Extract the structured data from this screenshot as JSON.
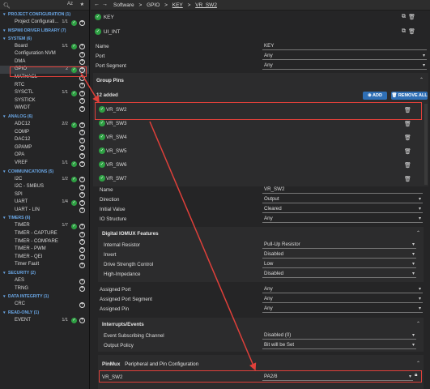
{
  "left": {
    "search_icon": "search-icon",
    "sort_label": "Az",
    "star_icon": "star-icon",
    "sections": [
      {
        "title": "PROJECT CONFIGURATION (1)",
        "items": [
          {
            "label": "Project Configurati...",
            "count": "1/1",
            "check": true
          }
        ]
      },
      {
        "title": "MSPM0 DRIVER LIBRARY (7)",
        "items": []
      },
      {
        "title": "SYSTEM (6)",
        "items": [
          {
            "label": "Board",
            "count": "1/1",
            "check": true
          },
          {
            "label": "Configuration NVM",
            "count": "",
            "check": false
          },
          {
            "label": "DMA",
            "count": "",
            "check": false
          },
          {
            "label": "GPIO",
            "count": "2",
            "check": true,
            "selected": true
          },
          {
            "label": "MATHACL",
            "count": "",
            "check": false
          },
          {
            "label": "RTC",
            "count": "",
            "check": false
          },
          {
            "label": "SYSCTL",
            "count": "1/1",
            "check": true
          },
          {
            "label": "SYSTICK",
            "count": "",
            "check": false
          },
          {
            "label": "WWDT",
            "count": "",
            "check": false
          }
        ]
      },
      {
        "title": "ANALOG (6)",
        "items": [
          {
            "label": "ADC12",
            "count": "2/2",
            "check": true
          },
          {
            "label": "COMP",
            "count": "",
            "check": false
          },
          {
            "label": "DAC12",
            "count": "",
            "check": false
          },
          {
            "label": "GPAMP",
            "count": "",
            "check": false
          },
          {
            "label": "OPA",
            "count": "",
            "check": false
          },
          {
            "label": "VREF",
            "count": "1/1",
            "check": true
          }
        ]
      },
      {
        "title": "COMMUNICATIONS (5)",
        "items": [
          {
            "label": "I2C",
            "count": "1/2",
            "check": true
          },
          {
            "label": "I2C - SMBUS",
            "count": "",
            "check": false
          },
          {
            "label": "SPI",
            "count": "",
            "check": false
          },
          {
            "label": "UART",
            "count": "1/4",
            "check": true
          },
          {
            "label": "UART - LIN",
            "count": "",
            "check": false
          }
        ]
      },
      {
        "title": "TIMERS (6)",
        "items": [
          {
            "label": "TIMER",
            "count": "1/7",
            "check": true
          },
          {
            "label": "TIMER - CAPTURE",
            "count": "",
            "check": false
          },
          {
            "label": "TIMER - COMPARE",
            "count": "",
            "check": false
          },
          {
            "label": "TIMER - PWM",
            "count": "",
            "check": false
          },
          {
            "label": "TIMER - QEI",
            "count": "",
            "check": false
          },
          {
            "label": "Timer Fault",
            "count": "",
            "check": false
          }
        ]
      },
      {
        "title": "SECURITY (2)",
        "items": [
          {
            "label": "AES",
            "count": "",
            "check": false
          },
          {
            "label": "TRNG",
            "count": "",
            "check": false
          }
        ]
      },
      {
        "title": "DATA INTEGRITY (1)",
        "items": [
          {
            "label": "CRC",
            "count": "",
            "check": false
          }
        ]
      },
      {
        "title": "READ-ONLY (1)",
        "items": [
          {
            "label": "EVENT",
            "count": "1/1",
            "check": true
          }
        ]
      }
    ]
  },
  "topbar": {
    "back_icon": "back-arrow-icon",
    "forward_icon": "forward-arrow-icon",
    "breadcrumb": [
      "Software",
      ">",
      "GPIO",
      ">",
      "KEY",
      ">",
      "VR_SW2"
    ]
  },
  "pins": [
    {
      "label": "KEY"
    },
    {
      "label": "UI_INT"
    }
  ],
  "props_top": {
    "name_label": "Name",
    "name_value": "KEY",
    "port_label": "Port",
    "port_value": "Any",
    "port_segment_label": "Port Segment",
    "port_segment_value": "Any"
  },
  "group_pins": {
    "title": "Group Pins",
    "count": "12 added",
    "add_label": "ADD",
    "remove_all_label": "REMOVE ALL",
    "items": [
      "VR_SW2",
      "VR_SW3",
      "VR_SW4",
      "VR_SW5",
      "VR_SW6",
      "VR_SW7"
    ]
  },
  "pin_props": {
    "name_label": "Name",
    "name_value": "VR_SW2",
    "direction_label": "Direction",
    "direction_value": "Output",
    "initial_label": "Initial Value",
    "initial_value": "Cleared",
    "io_label": "IO Structure",
    "io_value": "Any"
  },
  "digital": {
    "title": "Digital IOMUX Features",
    "rows": [
      {
        "label": "Internal Resistor",
        "value": "Pull-Up Resistor"
      },
      {
        "label": "Invert",
        "value": "Disabled"
      },
      {
        "label": "Drive Strength Control",
        "value": "Low"
      },
      {
        "label": "High-Impedance",
        "value": "Disabled"
      }
    ]
  },
  "assigned": [
    {
      "label": "Assigned Port",
      "value": "Any"
    },
    {
      "label": "Assigned Port Segment",
      "value": "Any"
    },
    {
      "label": "Assigned Pin",
      "value": "Any"
    }
  ],
  "interrupts": {
    "title": "Interrupts/Events",
    "rows": [
      {
        "label": "Event Subscribing Channel",
        "value": "Disabled (0)"
      },
      {
        "label": "Output Policy",
        "value": "Bit will be Set"
      }
    ]
  },
  "pinmux": {
    "title_bold": "PinMux",
    "title_rest": "Peripheral and Pin Configuration",
    "pin_name": "VR_SW2",
    "pin_value": "PA2/8",
    "lock_icon": "lock-icon"
  },
  "colors": {
    "accent": "#2f6fb5",
    "check": "#2ea043",
    "highlight": "#e0403a",
    "category": "#6aa7e6"
  }
}
